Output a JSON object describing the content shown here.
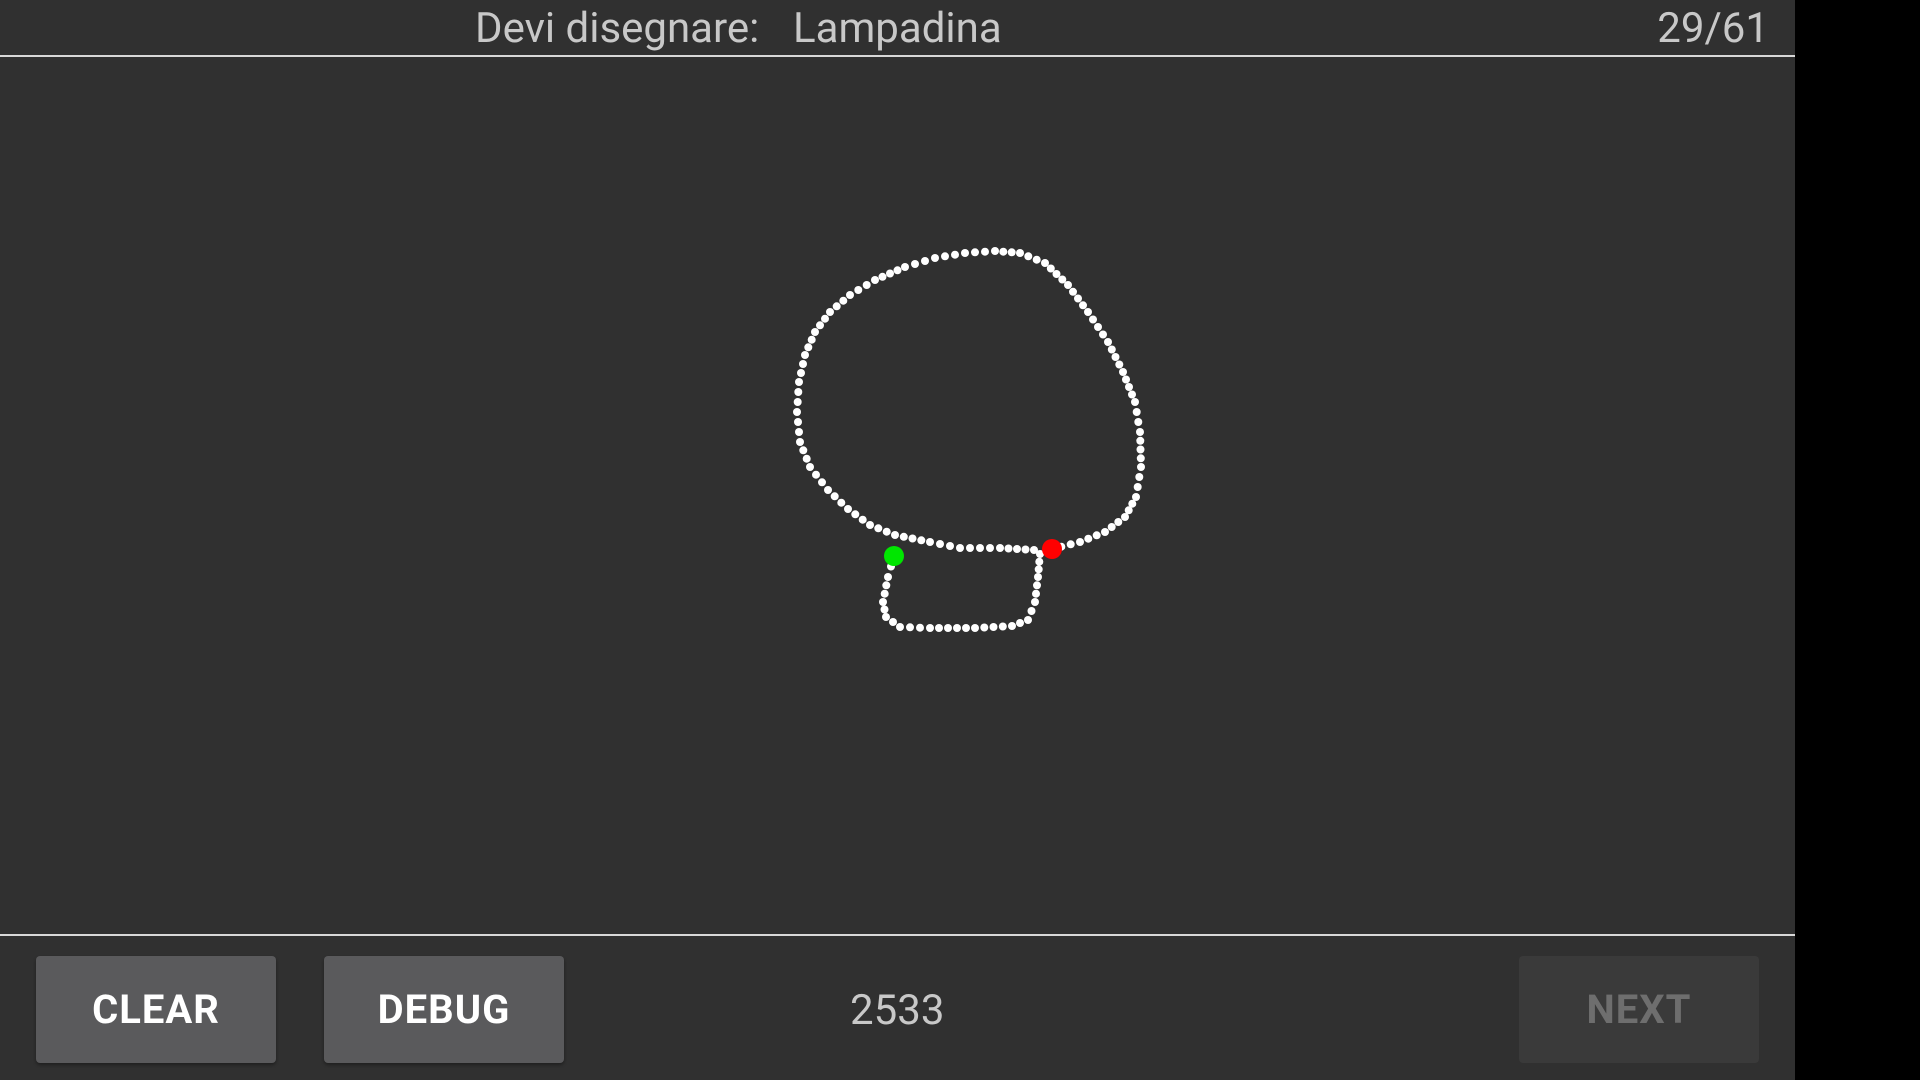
{
  "header": {
    "prompt_label": "Devi disegnare:",
    "prompt_word": "Lampadina",
    "progress": "29/61"
  },
  "drawing": {
    "stroke_color": "#ffffff",
    "start_marker_color": "#00e600",
    "end_marker_color": "#ff0000"
  },
  "footer": {
    "clear_label": "CLEAR",
    "debug_label": "DEBUG",
    "score": "2533",
    "next_label": "NEXT"
  }
}
